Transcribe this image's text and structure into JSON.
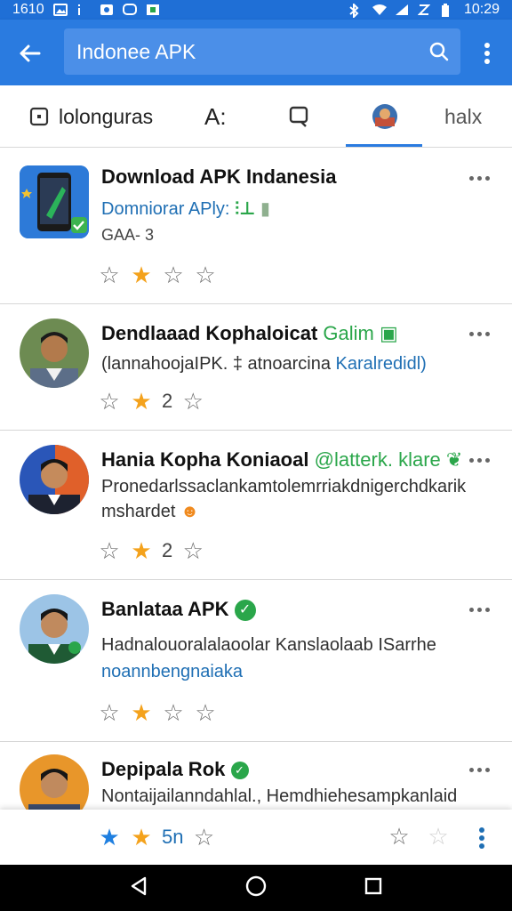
{
  "status_bar": {
    "time_left": "1610",
    "time_right": "10:29"
  },
  "app_bar": {
    "search_value": "Indonee APK"
  },
  "tabs": [
    {
      "label": "lolonguras",
      "icon": "square-icon"
    },
    {
      "label": "A:",
      "icon": "text-icon"
    },
    {
      "label": "",
      "icon": "chat-icon"
    },
    {
      "label": "",
      "icon": "avatar-icon"
    },
    {
      "label": "halx",
      "icon": ""
    }
  ],
  "items": [
    {
      "title": "Download APK Indanesia",
      "title_extra": "",
      "subtitle": "Domniorar APly:",
      "subtitle2": "GAA-  3",
      "rating_text": ""
    },
    {
      "title": "Dendlaaad Kophaloicat",
      "title_extra": "Galim",
      "subtitle": "(lannahoojaIPK. ‡ atnoarcina",
      "subtitle_blue": "Karalredidl)",
      "rating_text": "2"
    },
    {
      "title": "Hania Kopha Koniaoal",
      "title_extra": "@latterk. klare",
      "subtitle": "Pronedarlssaclankamtolemrriakdnigerchdkarik",
      "subtitle2": "mshardet",
      "rating_text": "2"
    },
    {
      "title": "Banlataa APK",
      "title_extra": "",
      "subtitle": "Hadnalouoralalaoolar Kanslaolaab ISarrhe",
      "subtitle_blue": "noannbengnaiaka",
      "rating_text": ""
    },
    {
      "title": "Depipala Rok",
      "title_extra": "",
      "subtitle": "Nontaijailanndahlal., Hemdhiehesampkanlaid",
      "rating_text": "5n"
    }
  ],
  "colors": {
    "app_bar": "#2a7be0",
    "star_filled": "#f4a21c",
    "star_blue": "#1f7fe0",
    "accent_green": "#2aa64a"
  }
}
